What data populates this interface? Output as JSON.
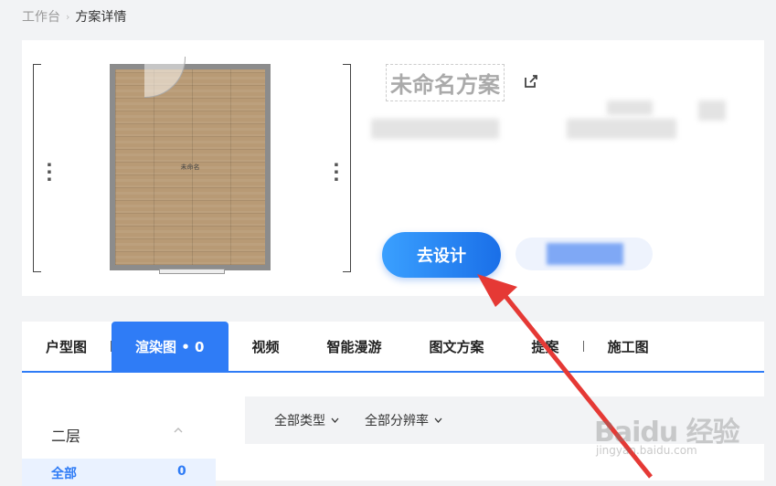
{
  "breadcrumb": {
    "root": "工作台",
    "current": "方案详情"
  },
  "plan": {
    "title": "未命名方案",
    "room_label": "未命名",
    "go_design_label": "去设计"
  },
  "tabs": [
    {
      "label": "户型图"
    },
    {
      "label": "渲染图 • 0",
      "active": true
    },
    {
      "label": "视频"
    },
    {
      "label": "智能漫游"
    },
    {
      "label": "图文方案"
    },
    {
      "label": "提案"
    },
    {
      "label": "施工图"
    }
  ],
  "sidebar": {
    "header": "二层",
    "items": [
      {
        "label": "全部",
        "count": "0"
      }
    ]
  },
  "filters": {
    "type": "全部类型",
    "resolution": "全部分辨率"
  },
  "watermark": {
    "main": "Baidu 经验",
    "sub": "jingyan.baidu.com"
  },
  "colors": {
    "accent": "#2f7cf6",
    "arrow": "#e53935"
  }
}
